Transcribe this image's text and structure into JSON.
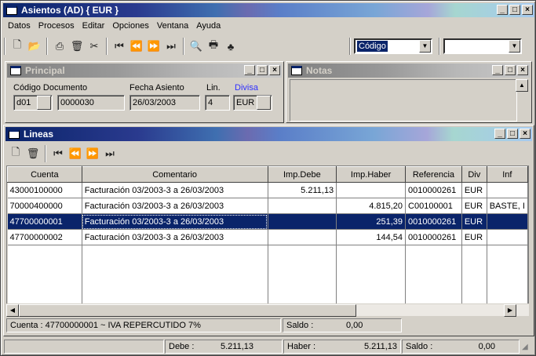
{
  "window": {
    "title": "Asientos (AD) { EUR }"
  },
  "menu": [
    "Datos",
    "Procesos",
    "Editar",
    "Opciones",
    "Ventana",
    "Ayuda"
  ],
  "toolbar": {
    "combo_value": "Código",
    "combo2_value": ""
  },
  "principal": {
    "title": "Principal",
    "labels": {
      "codigo": "Código Documento",
      "fecha": "Fecha Asiento",
      "lin": "Lin.",
      "divisa": "Divisa"
    },
    "values": {
      "serie": "d01",
      "documento": "0000030",
      "fecha": "26/03/2003",
      "lin": "4",
      "divisa": "EUR"
    }
  },
  "notas": {
    "title": "Notas"
  },
  "lineas": {
    "title": "Lineas",
    "columns": [
      "Cuenta",
      "Comentario",
      "Imp.Debe",
      "Imp.Haber",
      "Referencia",
      "Div",
      "Inf"
    ],
    "rows": [
      {
        "cuenta": "43000100000",
        "comentario": "Facturación 03/2003-3 a 26/03/2003",
        "debe": "5.211,13",
        "haber": "",
        "referencia": "0010000261",
        "div": "EUR",
        "inf": ""
      },
      {
        "cuenta": "70000400000",
        "comentario": "Facturación 03/2003-3 a 26/03/2003",
        "debe": "",
        "haber": "4.815,20",
        "referencia": "C00100001",
        "div": "EUR",
        "inf": "BASTE, I"
      },
      {
        "cuenta": "47700000001",
        "comentario": "Facturación 03/2003-3 a 26/03/2003",
        "debe": "",
        "haber": "251,39",
        "referencia": "0010000261",
        "div": "EUR",
        "inf": ""
      },
      {
        "cuenta": "47700000002",
        "comentario": "Facturación 03/2003-3 a 26/03/2003",
        "debe": "",
        "haber": "144,54",
        "referencia": "0010000261",
        "div": "EUR",
        "inf": ""
      }
    ],
    "status": {
      "cuenta": "Cuenta : 47700000001 ~ IVA REPERCUTIDO 7%",
      "saldo_label": "Saldo :",
      "saldo_value": "0,00"
    }
  },
  "footer": {
    "debe_label": "Debe :",
    "debe_value": "5.211,13",
    "haber_label": "Haber :",
    "haber_value": "5.211,13",
    "saldo_label": "Saldo :",
    "saldo_value": "0,00"
  }
}
